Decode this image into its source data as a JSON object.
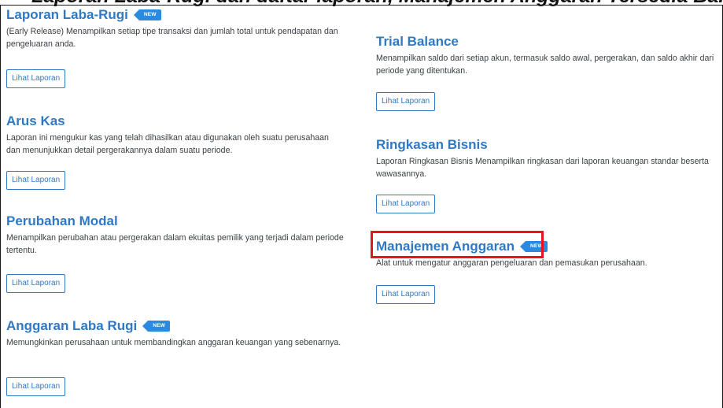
{
  "cut_heading": "Laporan Laba-Rugi dan daftar laporan, Manajemen Anggaran Tersedia Baru",
  "badge_new": "NEW",
  "button_label": "Lihat Laporan",
  "colors": {
    "title_blue": "#2f79c4",
    "badge_blue": "#2a8ae0",
    "highlight_red": "#e8131c"
  },
  "left_reports": [
    {
      "title": "Laporan Laba-Rugi",
      "desc": "(Early Release) Menampilkan setiap tipe transaksi dan jumlah total untuk pendapatan dan pengeluaran anda."
    },
    {
      "title": "Arus Kas",
      "desc": "Laporan ini mengukur kas yang telah dihasilkan atau digunakan oleh suatu perusahaan dan menunjukkan detail pergerakannya dalam suatu periode."
    },
    {
      "title": "Perubahan Modal",
      "desc": "Menampilkan perubahan atau pergerakan dalam ekuitas pemilik yang terjadi dalam periode tertentu."
    },
    {
      "title": "Anggaran Laba Rugi",
      "desc": "Memungkinkan perusahaan untuk membandingkan anggaran keuangan yang sebenarnya."
    }
  ],
  "right_reports": [
    {
      "title": "Trial Balance",
      "desc": "Menampilkan saldo dari setiap akun, termasuk saldo awal, pergerakan, dan saldo akhir dari periode yang ditentukan."
    },
    {
      "title": "Ringkasan Bisnis",
      "desc": "Laporan Ringkasan Bisnis Menampilkan ringkasan dari laporan keuangan standar beserta wawasannya."
    },
    {
      "title": "Manajemen Anggaran",
      "desc": "Alat untuk mengatur anggaran pengeluaran dan pemasukan perusahaan."
    }
  ]
}
